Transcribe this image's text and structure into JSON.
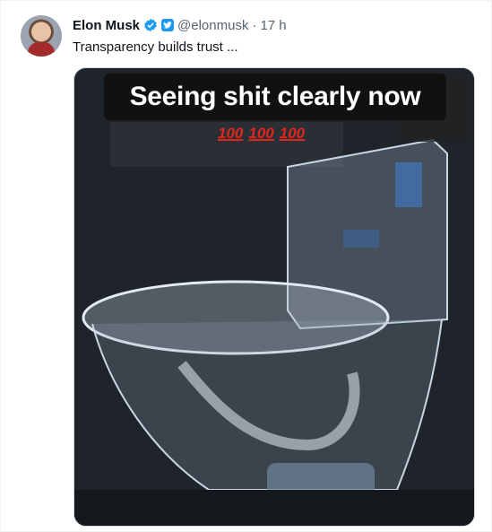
{
  "author": {
    "name": "Elon Musk",
    "handle": "@elonmusk",
    "separator": "·",
    "time": "17 h"
  },
  "tweet": {
    "text": "Transparency builds trust ..."
  },
  "media": {
    "caption": "Seeing shit clearly now",
    "emojis": [
      "100",
      "100",
      "100"
    ]
  },
  "colors": {
    "verified": "#1d9bf0",
    "caption_bg": "#111111",
    "emoji_red": "#e0261c"
  }
}
